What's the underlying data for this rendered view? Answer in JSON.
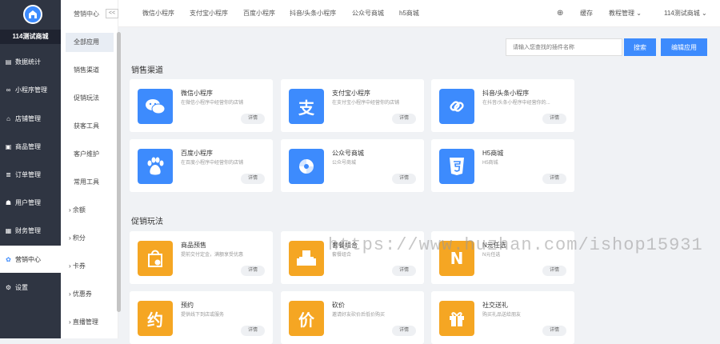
{
  "sidebar": {
    "shop_name": "114测试商城",
    "items": [
      {
        "label": "数据统计",
        "icon": "chart-icon"
      },
      {
        "label": "小程序管理",
        "icon": "link-icon"
      },
      {
        "label": "店铺管理",
        "icon": "store-icon"
      },
      {
        "label": "商品管理",
        "icon": "goods-icon"
      },
      {
        "label": "订单管理",
        "icon": "order-icon"
      },
      {
        "label": "用户管理",
        "icon": "user-icon"
      },
      {
        "label": "财务管理",
        "icon": "finance-icon"
      },
      {
        "label": "营销中心",
        "icon": "marketing-icon"
      },
      {
        "label": "设置",
        "icon": "gear-icon"
      }
    ]
  },
  "subnav": {
    "title": "营销中心",
    "collapse": "<<",
    "items": [
      "全部应用",
      "销售渠道",
      "促销玩法",
      "获客工具",
      "客户维护",
      "常用工具"
    ],
    "expand_items": [
      "余额",
      "积分",
      "卡券",
      "优惠券",
      "直播管理"
    ]
  },
  "topbar": {
    "channels": [
      "微信小程序",
      "支付宝小程序",
      "百度小程序",
      "抖音/头条小程序",
      "公众号商城",
      "h5商城"
    ],
    "cache": "缓存",
    "tutorial": "教程管理",
    "account": "114测试商城"
  },
  "search": {
    "placeholder": "请输入您查找的插件名称",
    "button": "搜索",
    "edit_button": "编辑应用"
  },
  "sections": [
    {
      "title": "销售渠道",
      "cards": [
        {
          "name": "微信小程序",
          "desc": "在微信小程序中经营你的店铺",
          "btn": "详情",
          "icon": "wechat-icon",
          "color": "#3d8bfd"
        },
        {
          "name": "支付宝小程序",
          "desc": "在支付宝小程序中经营你的店铺",
          "btn": "详情",
          "icon": "alipay-icon",
          "color": "#3d8bfd"
        },
        {
          "name": "抖音/头条小程序",
          "desc": "在抖音/头条小程序中经营你的...",
          "btn": "详情",
          "icon": "douyin-icon",
          "color": "#3d8bfd"
        },
        {
          "name": "百度小程序",
          "desc": "在百度小程序中经营你的店铺",
          "btn": "详情",
          "icon": "baidu-icon",
          "color": "#3d8bfd"
        },
        {
          "name": "公众号商城",
          "desc": "公众号商城",
          "btn": "详情",
          "icon": "mp-icon",
          "color": "#3d8bfd"
        },
        {
          "name": "H5商城",
          "desc": "H5商城",
          "btn": "详情",
          "icon": "html5-icon",
          "color": "#3d8bfd"
        }
      ]
    },
    {
      "title": "促销玩法",
      "cards": [
        {
          "name": "商品预售",
          "desc": "提前交付定金，满额享受优惠",
          "btn": "详情",
          "icon": "presale-icon",
          "color": "#f5a623"
        },
        {
          "name": "套餐组合",
          "desc": "套餐组合",
          "btn": "详情",
          "icon": "combo-icon",
          "color": "#f5a623"
        },
        {
          "name": "N元任选",
          "desc": "N元任选",
          "btn": "详情",
          "icon": "n-icon",
          "color": "#f5a623"
        },
        {
          "name": "预约",
          "desc": "提供线下到店或服务",
          "btn": "详情",
          "icon": "reserve-icon",
          "color": "#f5a623"
        },
        {
          "name": "砍价",
          "desc": "邀请好友砍价后低价购买",
          "btn": "详情",
          "icon": "bargain-icon",
          "color": "#f5a623"
        },
        {
          "name": "社交送礼",
          "desc": "购买礼品送给朋友",
          "btn": "详情",
          "icon": "gift-icon",
          "color": "#f5a623"
        }
      ]
    }
  ],
  "watermark": "https://www.huzhan.com/ishop15931"
}
